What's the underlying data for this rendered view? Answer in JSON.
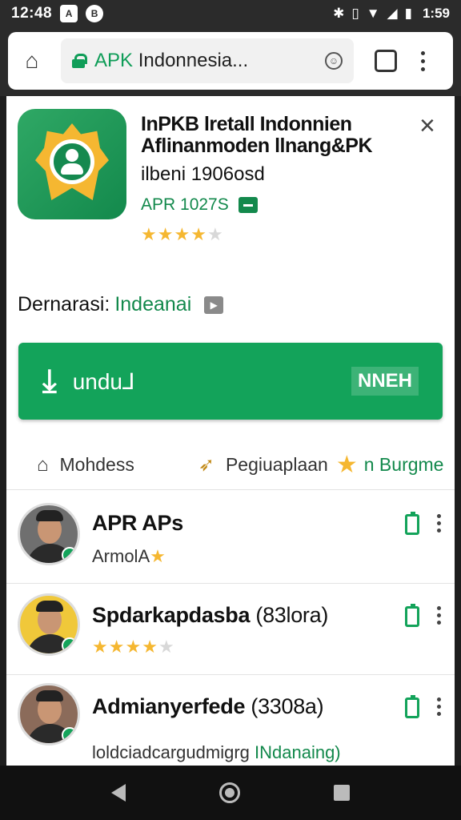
{
  "status_bar": {
    "time_left": "12:48",
    "icon_a": "A",
    "icon_b": "B",
    "time_right": "1:59",
    "icons": [
      "bluetooth-icon",
      "vibrate-icon",
      "wifi-icon",
      "signal-icon",
      "battery-icon"
    ]
  },
  "browser": {
    "url_host": "APK",
    "url_rest": " Indonnesia...",
    "tab_count": ""
  },
  "app": {
    "title": "InPKB lretall Indonnien Aflinanmoden llnang&PK",
    "subtitle": "ilbeni 1906osd",
    "version": "APR 1027S",
    "rating": 3.5,
    "close_label": "×"
  },
  "description": {
    "label": "Dernarasi:",
    "value": "Indeanai"
  },
  "download": {
    "label": "undu⅃",
    "right_label": "NNEH"
  },
  "tabs": [
    {
      "label": "Mohdess",
      "icon": "home-icon"
    },
    {
      "label": "Pegiuaplaan",
      "icon": "banana-icon"
    },
    {
      "label": "n Burgme",
      "icon": "star-icon"
    }
  ],
  "list": [
    {
      "name": "APR APs",
      "sub": "ArmolA",
      "sub_star": "★",
      "sub_type": "text"
    },
    {
      "name": "Spdarkapdasba",
      "name_suffix": " (83lora)",
      "rating": 3.5,
      "sub_type": "rating"
    },
    {
      "name": "Admianyerfede",
      "name_suffix": " (3308a)",
      "sub": "loldciadcargudmigrg",
      "sub_green": " INdanaing)",
      "sub_type": "text"
    }
  ],
  "colors": {
    "accent": "#13A35A",
    "accent_dark": "#13894C",
    "star": "#F5B731"
  }
}
